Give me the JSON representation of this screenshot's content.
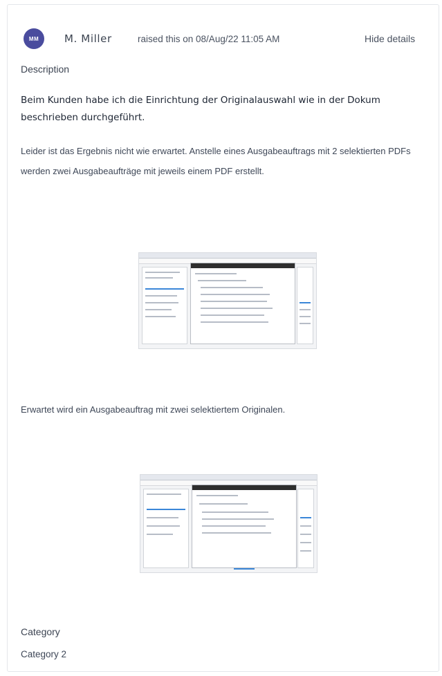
{
  "comment": {
    "avatar_initials": "MM",
    "author": "M. Miller",
    "raised_text": "raised this on 08/Aug/22 11:05 AM",
    "hide_details_label": "Hide details"
  },
  "description": {
    "label": "Description",
    "bold_paragraph": "Beim Kunden habe ich die Einrichtung der Originalauswahl wie in der Dokum beschrieben durchgeführt.",
    "paragraph": "Leider ist das Ergebnis nicht wie erwartet. Anstelle eines Ausgabeauftrags mit 2 selektierten PDFs werden zwei Ausgabeaufträge mit jeweils einem PDF erstellt.",
    "expected_paragraph": "Erwartet wird ein Ausgabeauftrag mit zwei selektiertem Originalen."
  },
  "category": {
    "label": "Category",
    "value": "Category 2"
  },
  "colors": {
    "avatar_bg": "#4a4c9e",
    "text": "#3e4757",
    "border": "#e4e6ea"
  }
}
